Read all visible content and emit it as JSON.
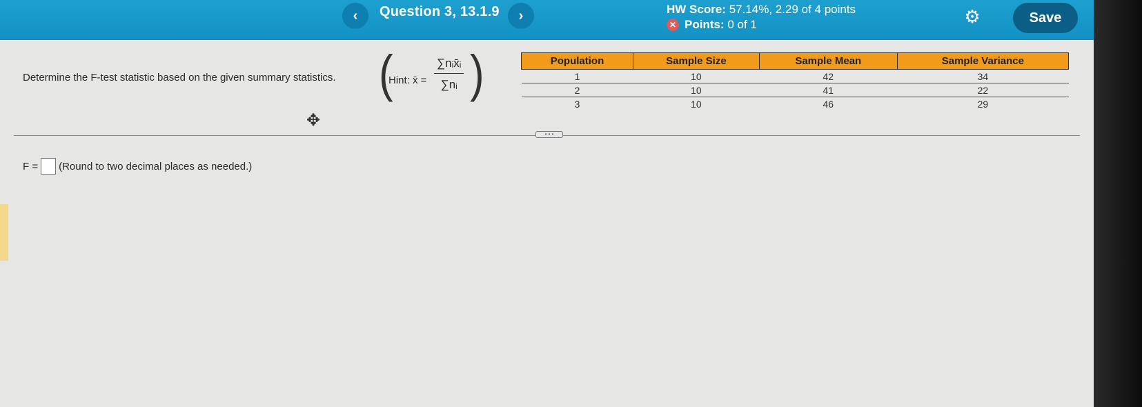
{
  "header": {
    "prev_symbol": "‹",
    "next_symbol": "›",
    "question_title": "Question 3, 13.1.9",
    "hw_score_label": "HW Score:",
    "hw_score_value": "57.14%, 2.29 of 4 points",
    "points_label": "Points:",
    "points_value": "0 of 1",
    "save_label": "Save"
  },
  "question": {
    "text": "Determine the F-test statistic based on the given summary statistics.",
    "hint_label": "Hint: x̄ =",
    "hint_numerator": "∑nᵢx̄ᵢ",
    "hint_denominator": "∑nᵢ"
  },
  "table": {
    "headers": [
      "Population",
      "Sample Size",
      "Sample Mean",
      "Sample Variance"
    ],
    "rows": [
      [
        "1",
        "10",
        "42",
        "34"
      ],
      [
        "2",
        "10",
        "41",
        "22"
      ],
      [
        "3",
        "10",
        "46",
        "29"
      ]
    ]
  },
  "answer": {
    "prefix": "F =",
    "instruction": "(Round to two decimal places as needed.)"
  },
  "icons": {
    "prev": "chevron-left-icon",
    "next": "chevron-right-icon",
    "points_status": "x-circle-icon",
    "settings": "gear-icon",
    "move": "move-arrows-icon"
  },
  "colors": {
    "header": "#1a9dcd",
    "save_button": "#0b5f86",
    "table_header": "#f29a1a",
    "incorrect": "#e05a5a"
  }
}
